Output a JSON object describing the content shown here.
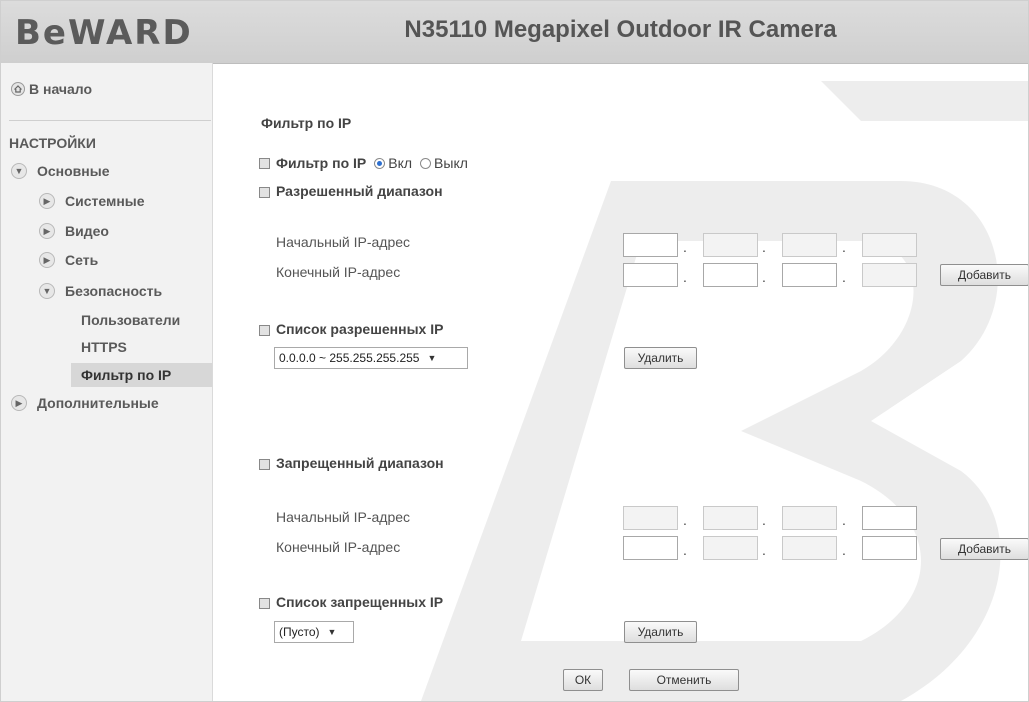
{
  "header": {
    "logo": "BeWARD",
    "title": "N35110 Megapixel Outdoor IR Camera"
  },
  "colors": {
    "header_bg": "#d4d4d4",
    "sidebar_bg": "#f2f2f2",
    "active_item_bg": "#d7d7d7",
    "radio_accent": "#2d6fcf"
  },
  "sidebar": {
    "home": "В начало",
    "section": "НАСТРОЙКИ",
    "basic": "Основные",
    "system": "Системные",
    "video": "Видео",
    "network": "Сеть",
    "security": "Безопасность",
    "users": "Пользователи",
    "https": "HTTPS",
    "ip_filter": "Фильтр по IP",
    "advanced": "Дополнительные"
  },
  "page": {
    "heading": "Фильтр по IP",
    "filter_label": "Фильтр по IP",
    "filter_on": "Вкл",
    "filter_off": "Выкл",
    "filter_value": "Вкл",
    "allowed_range": "Разрешенный диапазон",
    "allowed_start": "Начальный IP-адрес",
    "allowed_end": "Конечный IP-адрес",
    "allowed_add": "Добавить",
    "allowed_list": "Список разрешенных IP",
    "allowed_list_value": "0.0.0.0 ~ 255.255.255.255",
    "allowed_delete": "Удалить",
    "denied_range": "Запрещенный диапазон",
    "denied_start": "Начальный IP-адрес",
    "denied_end": "Конечный IP-адрес",
    "denied_add": "Добавить",
    "denied_list": "Список запрещенных IP",
    "denied_list_value": "(Пусто)",
    "denied_delete": "Удалить",
    "ok": "ОК",
    "cancel": "Отменить",
    "dot": "."
  }
}
